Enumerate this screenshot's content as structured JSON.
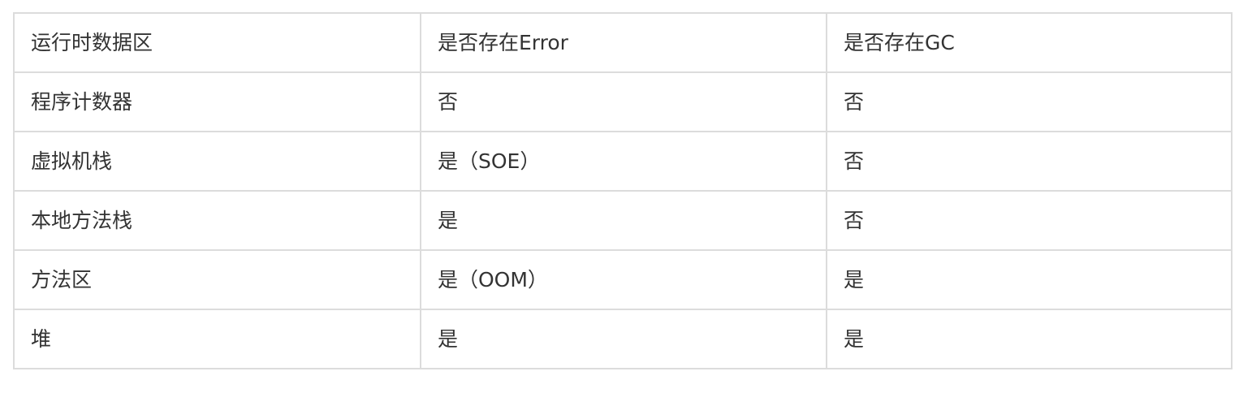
{
  "table": {
    "headers": [
      "运行时数据区",
      "是否存在Error",
      "是否存在GC"
    ],
    "rows": [
      [
        "程序计数器",
        "否",
        "否"
      ],
      [
        "虚拟机栈",
        "是（SOE）",
        "否"
      ],
      [
        "本地方法栈",
        "是",
        "否"
      ],
      [
        "方法区",
        "是（OOM）",
        "是"
      ],
      [
        "堆",
        "是",
        "是"
      ]
    ]
  }
}
